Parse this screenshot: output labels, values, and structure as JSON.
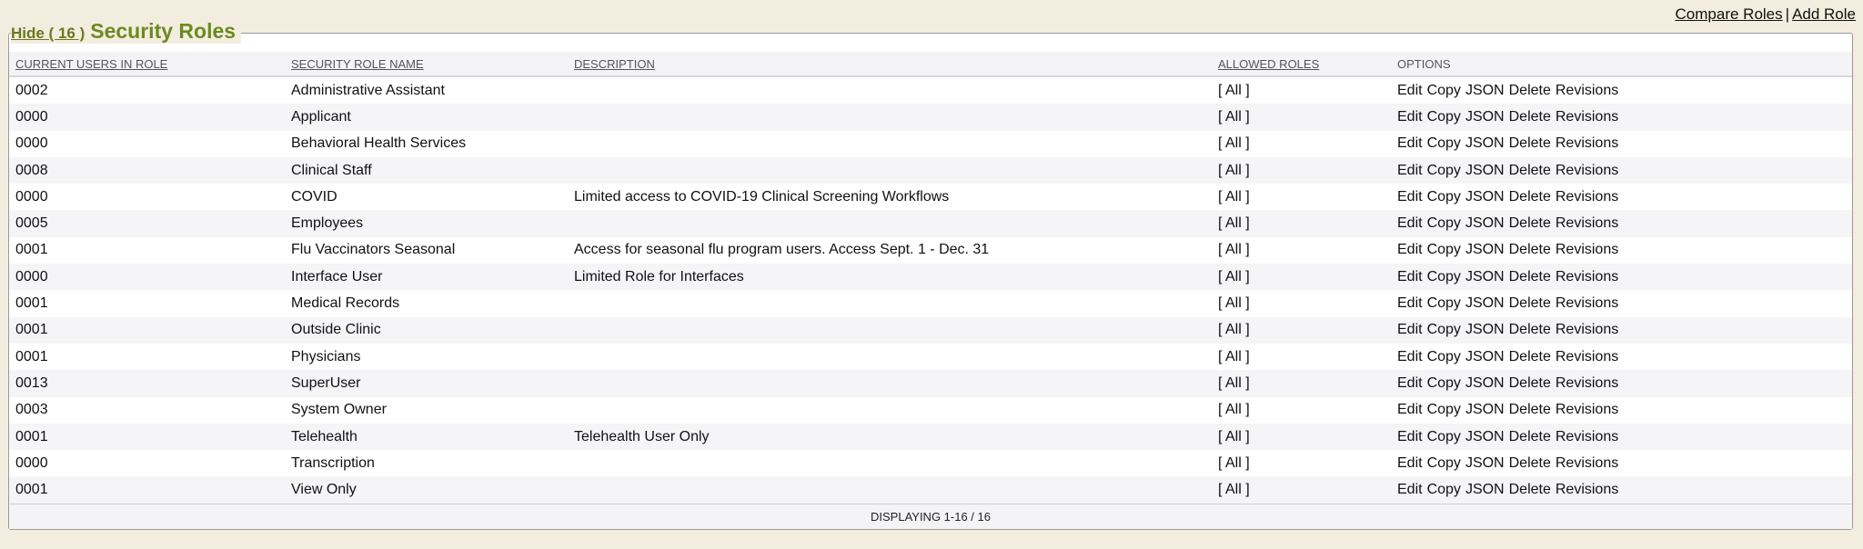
{
  "top_links": {
    "compare": "Compare Roles",
    "separator": "|",
    "add": "Add Role"
  },
  "panel": {
    "hide_label": "Hide ( 16 )",
    "title": "Security Roles"
  },
  "columns": {
    "users": "CURRENT USERS IN ROLE",
    "name": "SECURITY ROLE NAME",
    "description": "DESCRIPTION",
    "allowed": "ALLOWED ROLES",
    "options": "OPTIONS"
  },
  "option_labels": [
    "Edit",
    "Copy",
    "JSON",
    "Delete",
    "Revisions"
  ],
  "rows": [
    {
      "users": "0002",
      "name": "Administrative Assistant",
      "description": "",
      "allowed": "[ All ]"
    },
    {
      "users": "0000",
      "name": "Applicant",
      "description": "",
      "allowed": "[ All ]"
    },
    {
      "users": "0000",
      "name": "Behavioral Health Services",
      "description": "",
      "allowed": "[ All ]"
    },
    {
      "users": "0008",
      "name": "Clinical Staff",
      "description": "",
      "allowed": "[ All ]"
    },
    {
      "users": "0000",
      "name": "COVID",
      "description": "Limited access to COVID-19 Clinical Screening Workflows",
      "allowed": "[ All ]"
    },
    {
      "users": "0005",
      "name": "Employees",
      "description": "",
      "allowed": "[ All ]"
    },
    {
      "users": "0001",
      "name": "Flu Vaccinators Seasonal",
      "description": "Access for seasonal flu program users. Access Sept. 1 - Dec. 31",
      "allowed": "[ All ]"
    },
    {
      "users": "0000",
      "name": "Interface User",
      "description": "Limited Role for Interfaces",
      "allowed": "[ All ]"
    },
    {
      "users": "0001",
      "name": "Medical Records",
      "description": "",
      "allowed": "[ All ]"
    },
    {
      "users": "0001",
      "name": "Outside Clinic",
      "description": "",
      "allowed": "[ All ]"
    },
    {
      "users": "0001",
      "name": "Physicians",
      "description": "",
      "allowed": "[ All ]"
    },
    {
      "users": "0013",
      "name": "SuperUser",
      "description": "",
      "allowed": "[ All ]"
    },
    {
      "users": "0003",
      "name": "System Owner",
      "description": "",
      "allowed": "[ All ]"
    },
    {
      "users": "0001",
      "name": "Telehealth",
      "description": "Telehealth User Only",
      "allowed": "[ All ]"
    },
    {
      "users": "0000",
      "name": "Transcription",
      "description": "",
      "allowed": "[ All ]"
    },
    {
      "users": "0001",
      "name": "View Only",
      "description": "",
      "allowed": "[ All ]"
    }
  ],
  "footer": "DISPLAYING 1-16 / 16"
}
